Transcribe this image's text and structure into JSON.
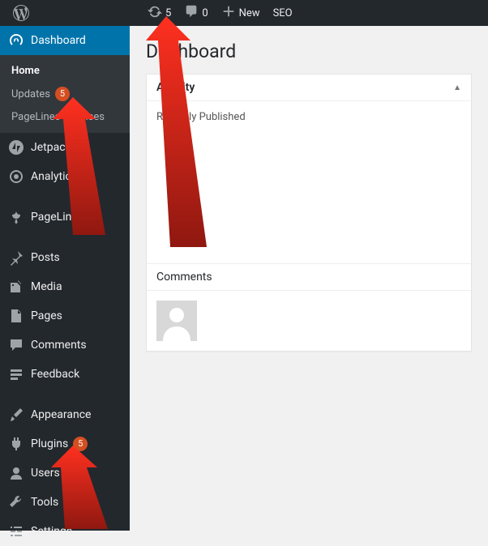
{
  "adminbar": {
    "updates_count": "5",
    "comments_count": "0",
    "new_label": "New",
    "seo_label": "SEO"
  },
  "sidebar": {
    "dashboard": "Dashboard",
    "submenu": {
      "home": "Home",
      "updates": "Updates",
      "updates_badge": "5",
      "pagelines_licenses": "PageLines Licenses"
    },
    "items": [
      {
        "label": "Jetpack"
      },
      {
        "label": "Analytics"
      },
      {
        "label": "PageLines"
      },
      {
        "label": "Posts"
      },
      {
        "label": "Media"
      },
      {
        "label": "Pages"
      },
      {
        "label": "Comments"
      },
      {
        "label": "Feedback"
      },
      {
        "label": "Appearance"
      },
      {
        "label": "Plugins",
        "badge": "5"
      },
      {
        "label": "Users"
      },
      {
        "label": "Tools"
      },
      {
        "label": "Settings"
      }
    ]
  },
  "main": {
    "title": "Dashboard",
    "activity": {
      "header": "Activity",
      "recently_published": "Recently Published",
      "comments_header": "Comments"
    }
  }
}
